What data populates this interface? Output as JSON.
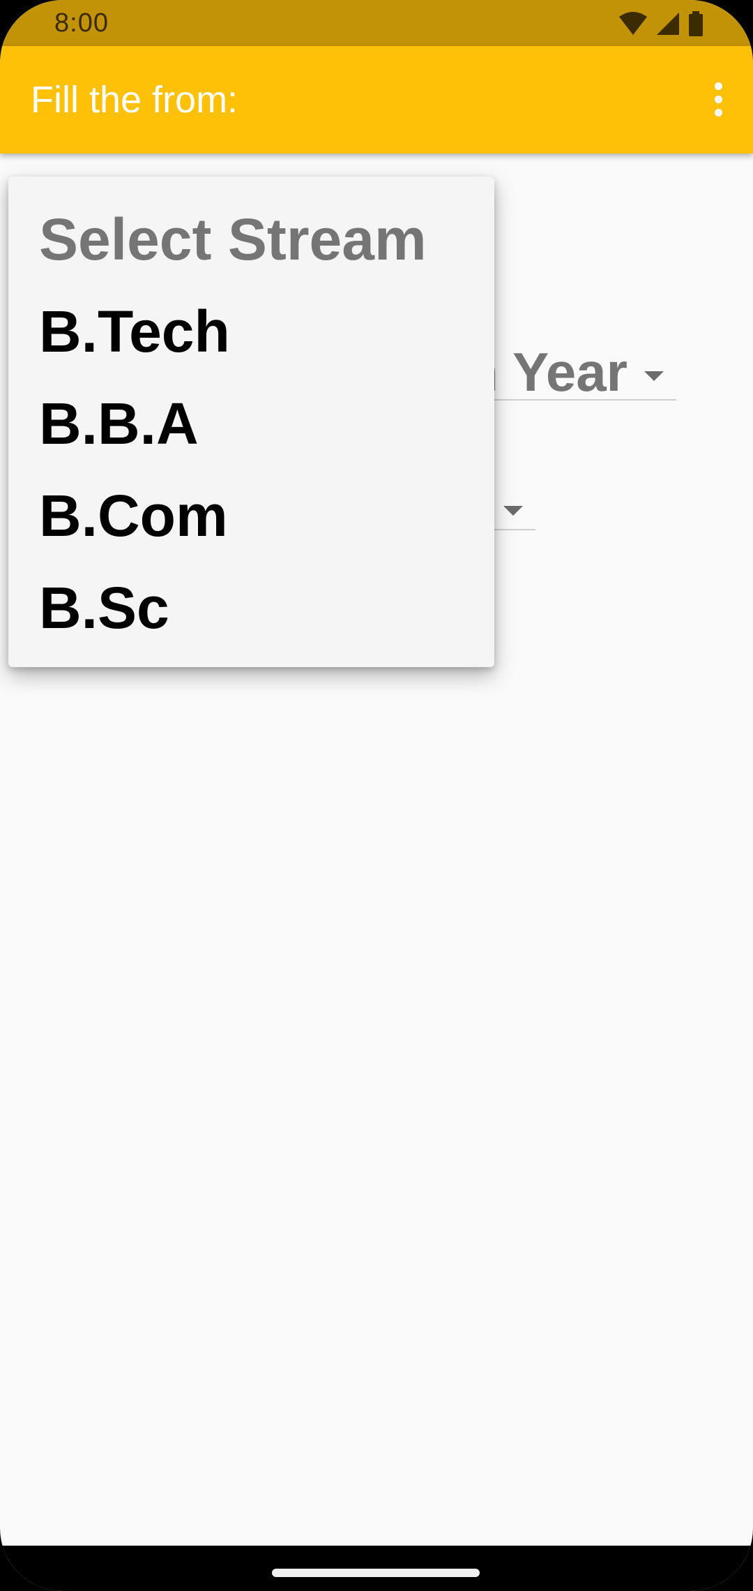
{
  "status_bar": {
    "time": "8:00",
    "icons": [
      "wifi-icon",
      "cellular-signal-icon",
      "battery-icon"
    ]
  },
  "app_bar": {
    "title": "Fill the from:",
    "overflow_icon": "more-vert-icon",
    "color": "#ffc107"
  },
  "form": {
    "year_spinner": {
      "visible_text": "n Year"
    }
  },
  "stream_dropdown": {
    "items": [
      {
        "label": "Select Stream",
        "is_hint": true
      },
      {
        "label": "B.Tech",
        "is_hint": false
      },
      {
        "label": "B.B.A",
        "is_hint": false
      },
      {
        "label": "B.Com",
        "is_hint": false
      },
      {
        "label": "B.Sc",
        "is_hint": false
      }
    ]
  },
  "colors": {
    "status_bar": "#c29306",
    "accent": "#ffc107",
    "background": "#fafafa",
    "hint_text": "#757575"
  }
}
